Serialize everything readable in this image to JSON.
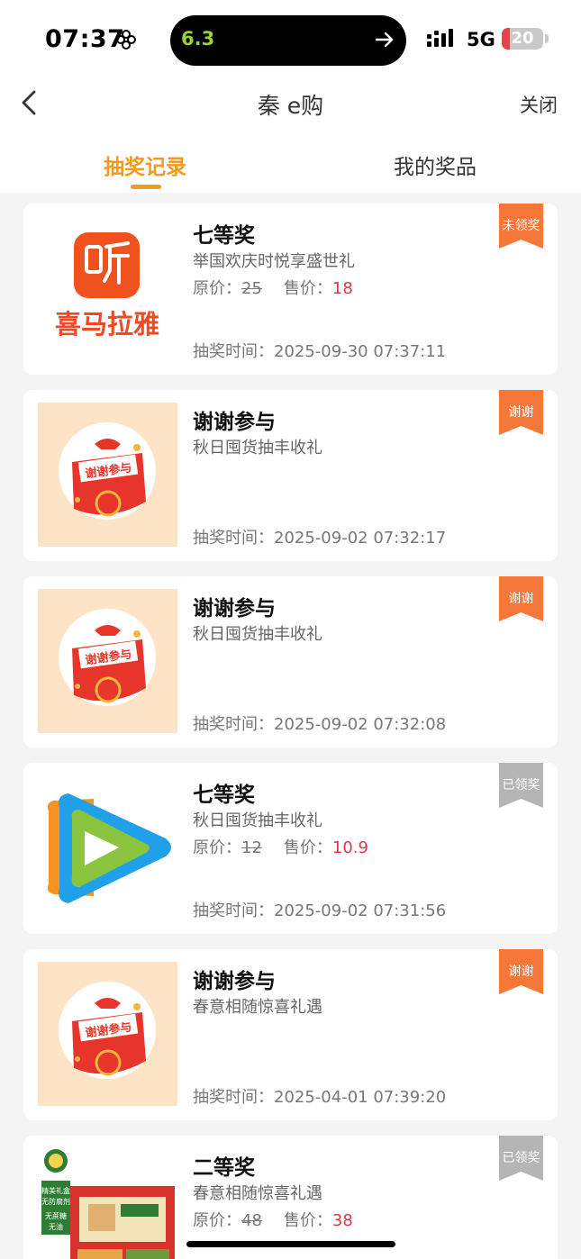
{
  "status_bar": {
    "time": "07:37",
    "island_text": "6.3",
    "network": "5G",
    "battery": "20",
    "battery_level": 0.2
  },
  "nav": {
    "title": "秦 e购",
    "close_label": "关闭"
  },
  "tabs": [
    {
      "label": "抽奖记录",
      "active": true
    },
    {
      "label": "我的奖品",
      "active": false
    }
  ],
  "labels": {
    "orig_price": "原价：",
    "sale_price": "售价：",
    "draw_time": "抽奖时间："
  },
  "records": [
    {
      "prize": "七等奖",
      "activity": "举国欢庆时悦享盛世礼",
      "original_price": "25",
      "sale_price": "18",
      "time": "2025-09-30 07:37:11",
      "status": "未领奖",
      "image": "ximalaya-logo",
      "logo_text": "喜马拉雅"
    },
    {
      "prize": "谢谢参与",
      "activity": "秋日囤货抽丰收礼",
      "time": "2025-09-02 07:32:17",
      "status": "谢谢",
      "image": "thanks-badge",
      "badge_text": "谢谢参与"
    },
    {
      "prize": "谢谢参与",
      "activity": "秋日囤货抽丰收礼",
      "time": "2025-09-02 07:32:08",
      "status": "谢谢",
      "image": "thanks-badge",
      "badge_text": "谢谢参与"
    },
    {
      "prize": "七等奖",
      "activity": "秋日囤货抽丰收礼",
      "original_price": "12",
      "sale_price": "10.9",
      "time": "2025-09-02 07:31:56",
      "status": "已领奖",
      "image": "tencent-video-logo"
    },
    {
      "prize": "谢谢参与",
      "activity": "春意相随惊喜礼遇",
      "time": "2025-04-01 07:39:20",
      "status": "谢谢",
      "image": "thanks-badge",
      "badge_text": "谢谢参与"
    },
    {
      "prize": "二等奖",
      "activity": "春意相随惊喜礼遇",
      "original_price": "48",
      "sale_price": "38",
      "time": "",
      "status": "已领奖",
      "image": "tofu-gift-box",
      "box_text_1": "精美礼盒",
      "box_text_2": "无防腐剂",
      "box_text_3": "无蔗糖",
      "box_text_4": "无油"
    }
  ],
  "colors": {
    "accent": "#f29a1e",
    "ribbon_active": "#f5773a",
    "ribbon_claimed": "#b5b5b5",
    "sale_price": "#e0364a"
  }
}
